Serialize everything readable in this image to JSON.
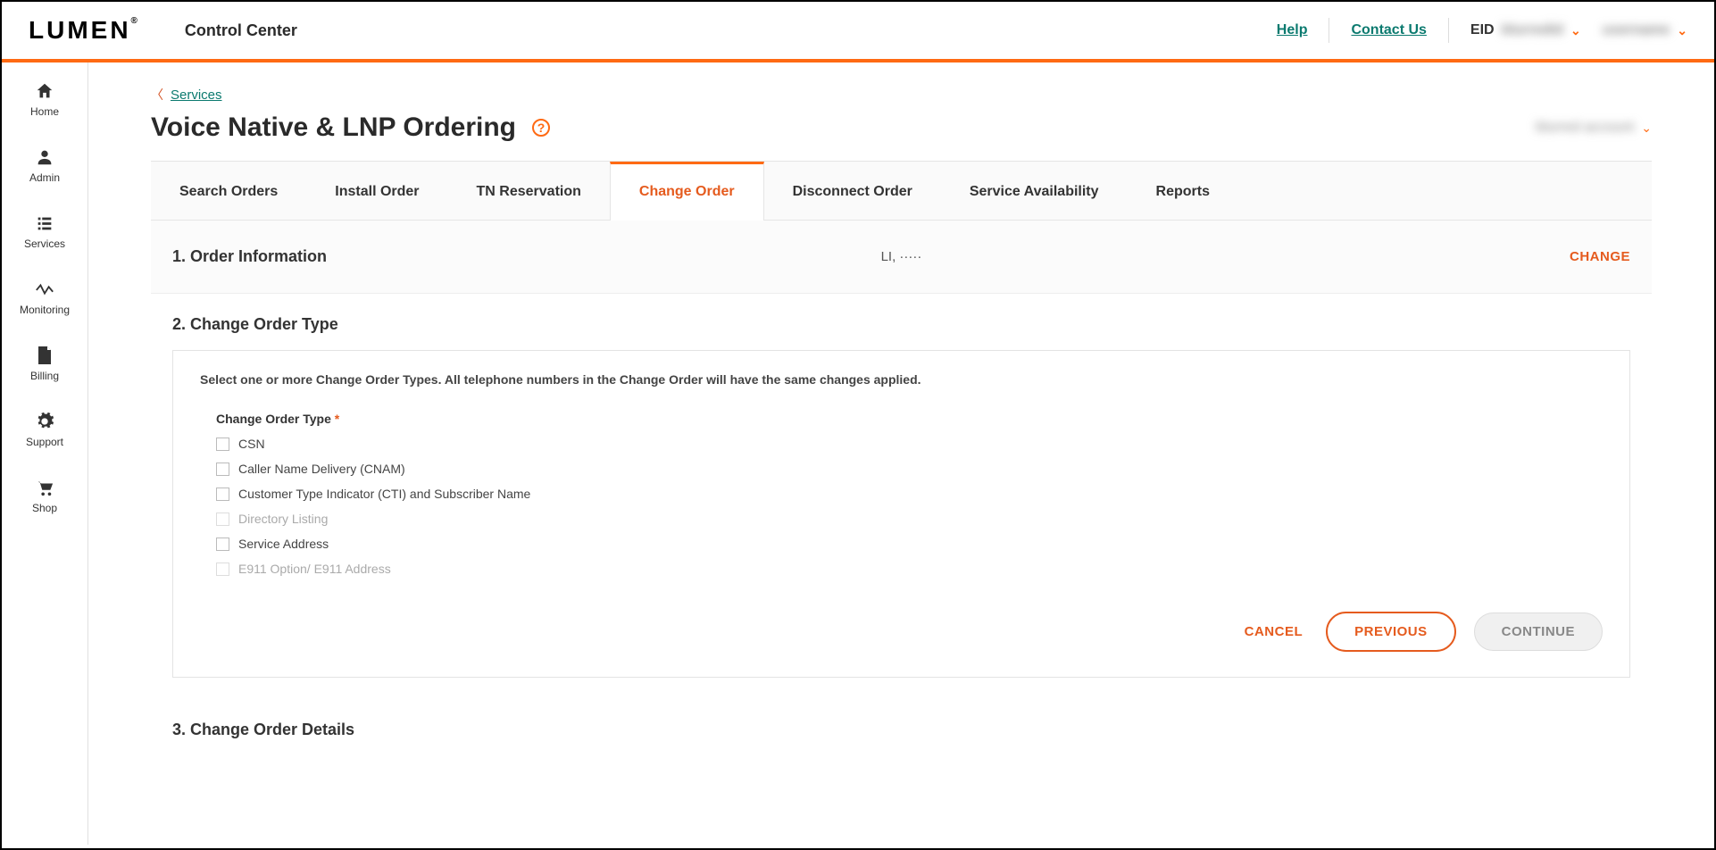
{
  "header": {
    "logo": "LUMEN",
    "app_title": "Control Center",
    "help": "Help",
    "contact": "Contact Us",
    "eid_label": "EID",
    "eid_value": "blurredid",
    "user_value": "username"
  },
  "sidebar": {
    "items": [
      {
        "label": "Home",
        "name": "sidebar-home"
      },
      {
        "label": "Admin",
        "name": "sidebar-admin"
      },
      {
        "label": "Services",
        "name": "sidebar-services"
      },
      {
        "label": "Monitoring",
        "name": "sidebar-monitoring"
      },
      {
        "label": "Billing",
        "name": "sidebar-billing"
      },
      {
        "label": "Support",
        "name": "sidebar-support"
      },
      {
        "label": "Shop",
        "name": "sidebar-shop"
      }
    ]
  },
  "breadcrumb": {
    "back": "Services"
  },
  "page": {
    "title": "Voice Native & LNP Ordering",
    "account": "blurred account"
  },
  "tabs": [
    {
      "label": "Search Orders"
    },
    {
      "label": "Install Order"
    },
    {
      "label": "TN Reservation"
    },
    {
      "label": "Change Order",
      "active": true
    },
    {
      "label": "Disconnect Order"
    },
    {
      "label": "Service Availability"
    },
    {
      "label": "Reports"
    }
  ],
  "step1": {
    "title": "1. Order Information",
    "value": "LI, ·····",
    "change": "CHANGE"
  },
  "step2": {
    "title": "2. Change Order Type",
    "instruction": "Select one or more Change Order Types. All telephone numbers in the Change Order will have the same changes applied.",
    "field_label": "Change Order Type",
    "options": [
      {
        "label": "CSN",
        "disabled": false
      },
      {
        "label": "Caller Name Delivery (CNAM)",
        "disabled": false
      },
      {
        "label": "Customer Type Indicator (CTI) and Subscriber Name",
        "disabled": false
      },
      {
        "label": "Directory Listing",
        "disabled": true
      },
      {
        "label": "Service Address",
        "disabled": false
      },
      {
        "label": "E911 Option/ E911 Address",
        "disabled": true
      }
    ],
    "buttons": {
      "cancel": "CANCEL",
      "previous": "PREVIOUS",
      "continue": "CONTINUE"
    }
  },
  "step3": {
    "title": "3. Change Order Details"
  }
}
